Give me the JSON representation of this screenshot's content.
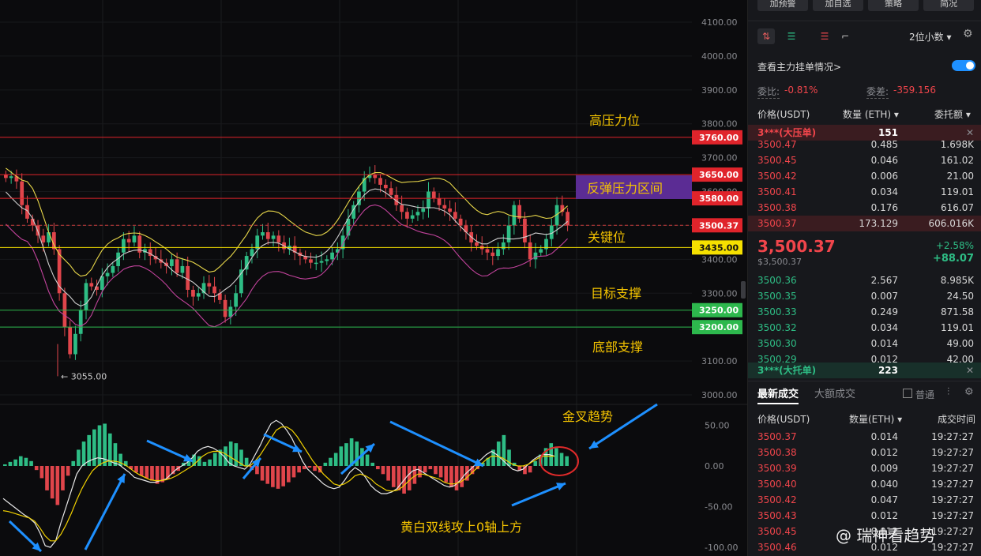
{
  "chart_data": {
    "type": "candlestick",
    "price_axis_ticks": [
      "4100.00",
      "4000.00",
      "3900.00",
      "3800.00",
      "3700.00",
      "3600.00",
      "3500.00",
      "3400.00",
      "3300.00",
      "3200.00",
      "3100.00",
      "3000.00"
    ],
    "price_ticks_values": [
      4100,
      4000,
      3900,
      3800,
      3700,
      3600,
      3500,
      3400,
      3300,
      3200,
      3100,
      3000
    ],
    "ylim": [
      2950,
      4170
    ],
    "low_marker": "← 3055.00",
    "macd_axis_ticks": [
      "50.00",
      "0.00",
      "-50.00",
      "-100.00"
    ],
    "macd_ticks_values": [
      50,
      0,
      -50,
      -100
    ],
    "macd_ylim": [
      -103,
      75
    ],
    "levels": [
      {
        "price": 3760,
        "label": "3760.00",
        "color": "#e0242b",
        "line": "#e0242b",
        "tag": "高压力位"
      },
      {
        "price": 3650,
        "label": "3650.00",
        "color": "#e0242b",
        "line": "#e0242b",
        "tag": ""
      },
      {
        "price": 3580,
        "label": "3580.00",
        "color": "#e0242b",
        "line": "#e0242b",
        "tag": "反弹压力区间"
      },
      {
        "price": 3500.37,
        "label": "3500.37",
        "color": "#e0242b",
        "line": "#c73a3a",
        "tag": "",
        "dashed": true
      },
      {
        "price": 3435,
        "label": "3435.00",
        "color": "#f5e000",
        "line": "#f5e000",
        "tag": "关键位",
        "dark_text": true
      },
      {
        "price": 3250,
        "label": "3250.00",
        "color": "#2db84d",
        "line": "#2db84d",
        "tag": "目标支撑"
      },
      {
        "price": 3200,
        "label": "3200.00",
        "color": "#2db84d",
        "line": "#2db84d",
        "tag": "底部支撑"
      }
    ],
    "close_series": [
      3640,
      3645,
      3630,
      3560,
      3520,
      3500,
      3470,
      3450,
      3480,
      3430,
      3300,
      3200,
      3120,
      3180,
      3250,
      3330,
      3320,
      3310,
      3350,
      3360,
      3380,
      3420,
      3460,
      3450,
      3470,
      3420,
      3430,
      3410,
      3400,
      3390,
      3380,
      3400,
      3360,
      3380,
      3310,
      3290,
      3300,
      3330,
      3320,
      3300,
      3280,
      3230,
      3260,
      3300,
      3370,
      3410,
      3430,
      3470,
      3480,
      3460,
      3470,
      3450,
      3430,
      3440,
      3420,
      3410,
      3400,
      3390,
      3390,
      3395,
      3400,
      3420,
      3430,
      3470,
      3520,
      3560,
      3600,
      3640,
      3650,
      3640,
      3620,
      3610,
      3590,
      3560,
      3540,
      3520,
      3530,
      3540,
      3550,
      3600,
      3580,
      3560,
      3550,
      3540,
      3520,
      3500,
      3480,
      3450,
      3440,
      3430,
      3420,
      3410,
      3430,
      3450,
      3500,
      3560,
      3520,
      3450,
      3400,
      3420,
      3430,
      3460,
      3500,
      3560,
      3540,
      3500
    ],
    "macd_hist": [
      2,
      5,
      8,
      12,
      10,
      6,
      -5,
      -15,
      -30,
      -40,
      -48,
      -30,
      -12,
      6,
      20,
      30,
      38,
      45,
      50,
      52,
      40,
      28,
      15,
      6,
      -4,
      -8,
      -12,
      -15,
      -18,
      -22,
      -20,
      -16,
      -10,
      -6,
      4,
      10,
      14,
      12,
      5,
      8,
      16,
      20,
      24,
      30,
      28,
      20,
      10,
      -5,
      -10,
      -18,
      -22,
      -26,
      -28,
      -25,
      -20,
      -14,
      -8,
      -4,
      -2,
      -6,
      -8,
      4,
      10,
      16,
      24,
      28,
      34,
      30,
      22,
      14,
      4,
      -4,
      -10,
      -18,
      -26,
      -30,
      -34,
      -30,
      -22,
      -14,
      -8,
      -4,
      -10,
      -14,
      -20,
      -26,
      -30,
      -26,
      -18,
      -10,
      -4,
      4,
      10,
      20,
      30,
      38,
      20,
      4,
      -6,
      -10,
      -8,
      6,
      14,
      22,
      28,
      22,
      16,
      12
    ],
    "dif_line": [
      -40,
      -45,
      -50,
      -55,
      -60,
      -64,
      -70,
      -82,
      -98,
      -100,
      -92,
      -70,
      -50,
      -30,
      -10,
      0,
      5,
      8,
      10,
      9,
      7,
      4,
      2,
      -3,
      -8,
      -14,
      -16,
      -18,
      -20,
      -20,
      -18,
      -16,
      -10,
      -4,
      0,
      4,
      10,
      18,
      22,
      24,
      22,
      18,
      12,
      4,
      0,
      -2,
      -4,
      2,
      14,
      26,
      40,
      52,
      56,
      52,
      44,
      34,
      20,
      6,
      -4,
      -10,
      -16,
      -22,
      -26,
      -28,
      -26,
      -18,
      -8,
      -2,
      -6,
      -14,
      -24,
      -30,
      -34,
      -34,
      -32,
      -28,
      -20,
      -12,
      -6,
      -4,
      -8,
      -12,
      -16,
      -20,
      -24,
      -26,
      -24,
      -18,
      -10,
      -4,
      2,
      8,
      14,
      18,
      14,
      8,
      2,
      -4,
      -6,
      -4,
      2,
      8,
      12,
      14,
      14,
      12
    ],
    "dea_line": [
      -55,
      -56,
      -58,
      -60,
      -62,
      -64,
      -68,
      -76,
      -86,
      -92,
      -92,
      -84,
      -72,
      -58,
      -42,
      -28,
      -16,
      -6,
      0,
      4,
      6,
      6,
      5,
      2,
      -2,
      -7,
      -11,
      -14,
      -17,
      -18,
      -18,
      -17,
      -15,
      -12,
      -8,
      -4,
      0,
      6,
      12,
      16,
      18,
      18,
      16,
      12,
      8,
      4,
      0,
      0,
      6,
      14,
      24,
      34,
      44,
      48,
      48,
      44,
      36,
      26,
      16,
      6,
      -2,
      -10,
      -16,
      -22,
      -24,
      -22,
      -18,
      -12,
      -10,
      -12,
      -16,
      -22,
      -26,
      -30,
      -31,
      -30,
      -26,
      -20,
      -14,
      -10,
      -10,
      -12,
      -14,
      -16,
      -20,
      -22,
      -22,
      -20,
      -16,
      -10,
      -4,
      2,
      8,
      12,
      12,
      10,
      6,
      2,
      0,
      0,
      2,
      6,
      10,
      12,
      12,
      12
    ]
  },
  "annotations": {
    "gao_ya": "高压力位",
    "fan_tan": "反弹压力区间",
    "guan_jian": "关键位",
    "mu_biao": "目标支撑",
    "di_bu": "底部支撑",
    "jin_cha": "金叉趋势",
    "huang_bai": "黄白双线攻上0轴上方",
    "watermark": "@ 瑞神看趋势"
  },
  "panel": {
    "top_buttons": [
      "加预警",
      "加自选",
      "策略",
      "简况"
    ],
    "decimals": "2位小数 ▾",
    "check_orders": "查看主力挂单情况>",
    "wei_bi_label": "委比:",
    "wei_bi_value": "-0.81%",
    "wei_cha_label": "委差:",
    "wei_cha_value": "-359.156",
    "header_price": "价格(USDT)",
    "header_qty": "数量 (ETH) ▾",
    "header_amount": "委托额 ▾",
    "big_ask_label": "3***(大压单)",
    "big_ask_qty": "151",
    "asks": [
      {
        "p": "3500.47",
        "q": "0.485",
        "a": "1.698K"
      },
      {
        "p": "3500.45",
        "q": "0.046",
        "a": "161.02"
      },
      {
        "p": "3500.42",
        "q": "0.006",
        "a": "21.00"
      },
      {
        "p": "3500.41",
        "q": "0.034",
        "a": "119.01"
      },
      {
        "p": "3500.38",
        "q": "0.176",
        "a": "616.07"
      },
      {
        "p": "3500.37",
        "q": "173.129",
        "a": "606.016K"
      }
    ],
    "last_price": "3,500.37",
    "last_price_sub": "$3,500.37",
    "change_pct": "+2.58%",
    "change_val": "+88.07",
    "bids": [
      {
        "p": "3500.36",
        "q": "2.567",
        "a": "8.985K"
      },
      {
        "p": "3500.35",
        "q": "0.007",
        "a": "24.50"
      },
      {
        "p": "3500.33",
        "q": "0.249",
        "a": "871.58"
      },
      {
        "p": "3500.32",
        "q": "0.034",
        "a": "119.01"
      },
      {
        "p": "3500.30",
        "q": "0.014",
        "a": "49.00"
      },
      {
        "p": "3500.29",
        "q": "0.012",
        "a": "42.00"
      }
    ],
    "big_bid_label": "3***(大托单)",
    "big_bid_qty": "223",
    "trades_tab": "最新成交",
    "big_trades_tab": "大额成交",
    "normal_label": "普通",
    "trade_h_price": "价格(USDT)",
    "trade_h_qty": "数量(ETH) ▾",
    "trade_h_time": "成交时间",
    "trades": [
      {
        "p": "3500.37",
        "q": "0.014",
        "t": "19:27:27"
      },
      {
        "p": "3500.38",
        "q": "0.012",
        "t": "19:27:27"
      },
      {
        "p": "3500.39",
        "q": "0.009",
        "t": "19:27:27"
      },
      {
        "p": "3500.40",
        "q": "0.040",
        "t": "19:27:27"
      },
      {
        "p": "3500.42",
        "q": "0.047",
        "t": "19:27:27"
      },
      {
        "p": "3500.43",
        "q": "0.012",
        "t": "19:27:27"
      },
      {
        "p": "3500.45",
        "q": "0.012",
        "t": "19:27:27"
      },
      {
        "p": "3500.46",
        "q": "0.012",
        "t": "19:27:27"
      }
    ]
  },
  "colors": {
    "up": "#2ebd85",
    "down": "#e0454b",
    "yellow": "#f5e000",
    "annotation": "#f5c400",
    "arrow": "#1e90ff"
  }
}
